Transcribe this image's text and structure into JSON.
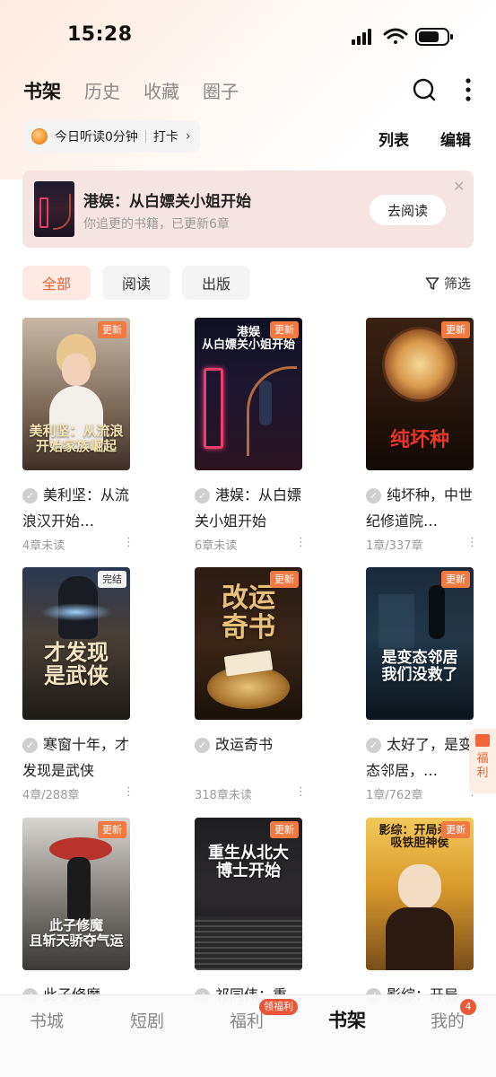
{
  "status_bar": {
    "time": "15:28"
  },
  "header": {
    "tabs": [
      {
        "label": "书架",
        "active": true
      },
      {
        "label": "历史",
        "active": false
      },
      {
        "label": "收藏",
        "active": false
      },
      {
        "label": "圈子",
        "active": false
      }
    ]
  },
  "listen_bar": {
    "text": "今日听读0分钟",
    "checkin": "打卡",
    "chevron": "›"
  },
  "view_controls": {
    "list": "列表",
    "edit": "编辑"
  },
  "banner": {
    "title": "港娱：从白嫖关小姐开始",
    "subtitle": "你追更的书籍，已更新6章",
    "button": "去阅读",
    "close": "✕"
  },
  "filters": {
    "chips": [
      {
        "label": "全部",
        "active": true
      },
      {
        "label": "阅读",
        "active": false
      },
      {
        "label": "出版",
        "active": false
      }
    ],
    "filter_label": "筛选"
  },
  "books": [
    {
      "title": "美利坚：从流浪汉开始…",
      "meta": "4章未读",
      "badge": "更新",
      "cover_text": "美利坚：从流浪\n开始家族崛起"
    },
    {
      "title": "港娱：从白嫖关小姐开始",
      "meta": "6章未读",
      "badge": "更新",
      "cover_text": "港娱\n从白嫖关小姐开始"
    },
    {
      "title": "纯坏种，中世纪修道院…",
      "meta": "1章/337章",
      "badge": "更新",
      "cover_text": "纯坏种"
    },
    {
      "title": "寒窗十年，才发现是武侠",
      "meta": "4章/288章",
      "badge": "完结",
      "cover_text": "才发现\n是武侠"
    },
    {
      "title": "改运奇书",
      "meta": "318章未读",
      "badge": "更新",
      "cover_text": "改运\n奇书"
    },
    {
      "title": "太好了，是变态邻居，…",
      "meta": "1章/762章",
      "badge": "更新",
      "cover_text": "是变态邻居\n我们没救了"
    },
    {
      "title": "此子修魔",
      "meta": "",
      "badge": "更新",
      "cover_text": "此子修魔\n且斩天骄夺气运"
    },
    {
      "title": "祁同伟：重",
      "meta": "",
      "badge": "更新",
      "cover_text": "重生从北大\n博士开始"
    },
    {
      "title": "影综：开局",
      "meta": "",
      "badge": "更新",
      "cover_text": "影综：开局杀一\n吸铁胆神侯"
    }
  ],
  "side_float": {
    "label": "福利"
  },
  "bottom_nav": {
    "items": [
      {
        "label": "书城",
        "active": false
      },
      {
        "label": "短剧",
        "active": false
      },
      {
        "label": "福利",
        "active": false,
        "badge": "领福利"
      },
      {
        "label": "书架",
        "active": true
      },
      {
        "label": "我的",
        "active": false,
        "badge": "4"
      }
    ]
  },
  "colors": {
    "accent": "#e8612e",
    "badge": "#f07a42",
    "banner_bg": "#f6e4e3"
  }
}
